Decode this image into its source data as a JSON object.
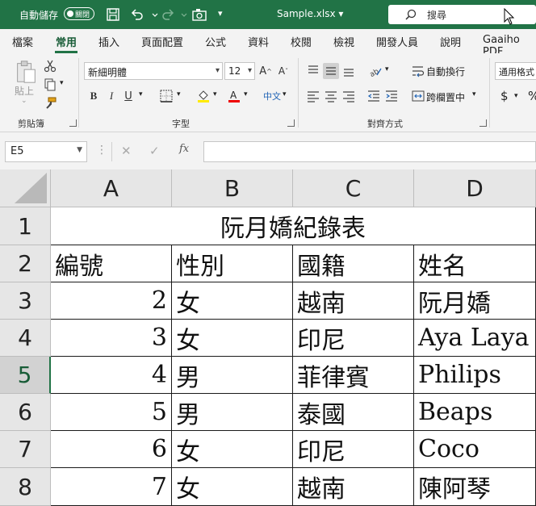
{
  "titlebar": {
    "autosave_label": "自動儲存",
    "autosave_toggle": "關閉",
    "filename": "Sample.xlsx",
    "search_placeholder": "搜尋",
    "qa_more": "▾"
  },
  "tabs": [
    "檔案",
    "常用",
    "插入",
    "頁面配置",
    "公式",
    "資料",
    "校閱",
    "檢視",
    "開發人員",
    "說明",
    "Gaaiho PDF"
  ],
  "ribbon": {
    "clipboard": {
      "label": "剪貼簿",
      "paste": "貼上"
    },
    "font": {
      "label": "字型",
      "font_name": "新細明體",
      "font_size": "12",
      "phonetic": "中文"
    },
    "alignment": {
      "label": "對齊方式",
      "wrap_text": "自動換行",
      "merge_center": "跨欄置中"
    },
    "number": {
      "format": "通用格式",
      "currency": "$",
      "percent": "%"
    }
  },
  "formula_bar": {
    "name_box": "E5",
    "formula": ""
  },
  "sheet": {
    "selected_row": 5,
    "columns": [
      "A",
      "B",
      "C",
      "D"
    ],
    "row_numbers": [
      "1",
      "2",
      "3",
      "4",
      "5",
      "6",
      "7",
      "8"
    ],
    "title": "阮月嬌紀錄表",
    "header": [
      "編號",
      "性別",
      "國籍",
      "姓名"
    ],
    "rows": [
      [
        "2",
        "女",
        "越南",
        "阮月嬌"
      ],
      [
        "3",
        "女",
        "印尼",
        "Aya Laya"
      ],
      [
        "4",
        "男",
        "菲律賓",
        "Philips"
      ],
      [
        "5",
        "男",
        "泰國",
        "Beaps"
      ],
      [
        "6",
        "女",
        "印尼",
        "Coco"
      ],
      [
        "7",
        "女",
        "越南",
        "陳阿琴"
      ]
    ]
  },
  "colors": {
    "excel_green": "#217346",
    "ribbon_bg": "#f3f3f3",
    "header_bg": "#e6e6e6"
  }
}
